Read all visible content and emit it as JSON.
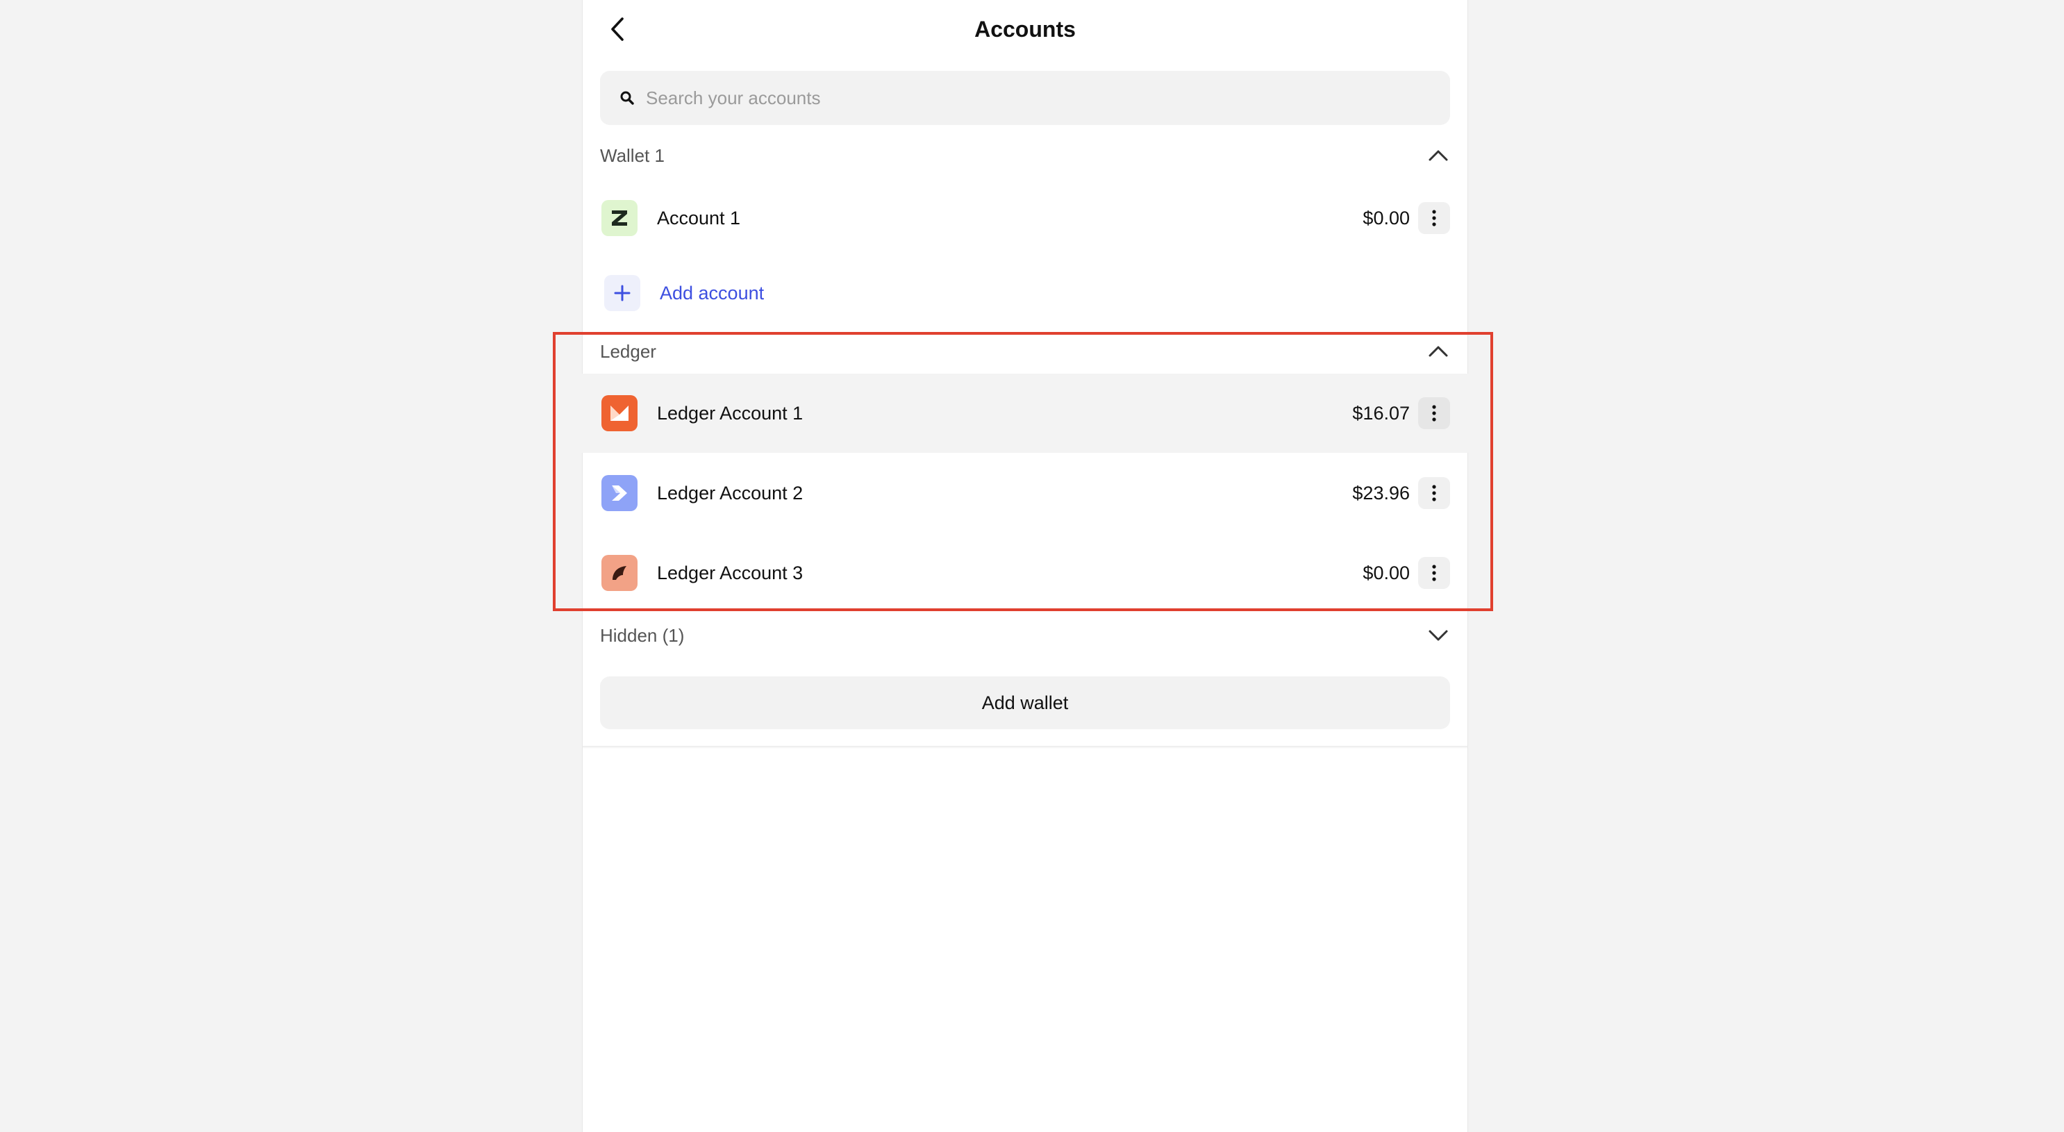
{
  "header": {
    "title": "Accounts",
    "back_icon": "chevron-left-icon"
  },
  "search": {
    "placeholder": "Search your accounts",
    "value": ""
  },
  "sections": [
    {
      "title": "Wallet 1",
      "expanded": true,
      "accounts": [
        {
          "name": "Account 1",
          "balance": "$0.00",
          "icon": "green-z-logo-icon"
        }
      ],
      "add_account_label": "Add account"
    },
    {
      "title": "Ledger",
      "expanded": true,
      "accounts": [
        {
          "name": "Ledger Account 1",
          "balance": "$16.07",
          "icon": "orange-m-logo-icon",
          "selected": true
        },
        {
          "name": "Ledger Account 2",
          "balance": "$23.96",
          "icon": "blue-arrow-logo-icon"
        },
        {
          "name": "Ledger Account 3",
          "balance": "$0.00",
          "icon": "coral-leaf-logo-icon"
        }
      ]
    },
    {
      "title": "Hidden (1)",
      "expanded": false
    }
  ],
  "footer": {
    "add_wallet_label": "Add wallet"
  },
  "colors": {
    "accent": "#3d4fe0",
    "highlight": "#e0402f",
    "background": "#f3f3f3",
    "panel": "#ffffff"
  }
}
